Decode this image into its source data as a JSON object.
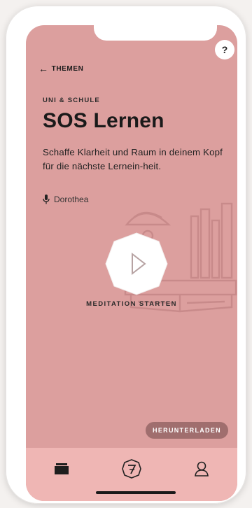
{
  "nav": {
    "back_label": "THEMEN",
    "help_label": "?"
  },
  "content": {
    "category": "UNI & SCHULE",
    "title": "SOS Lernen",
    "description": "Schaffe Klarheit und Raum in deinem Kopf für die nächste Lernein-heit.",
    "speaker": "Dorothea"
  },
  "player": {
    "start_label": "MEDITATION STARTEN"
  },
  "actions": {
    "download_label": "HERUNTERLADEN"
  },
  "tabbar": {
    "tabs": [
      {
        "icon": "stack-icon"
      },
      {
        "icon": "seven-logo-icon"
      },
      {
        "icon": "profile-icon"
      }
    ]
  },
  "colors": {
    "background": "#dc9f9e",
    "tabbar": "#efb6b4",
    "button": "#a06e6e"
  }
}
